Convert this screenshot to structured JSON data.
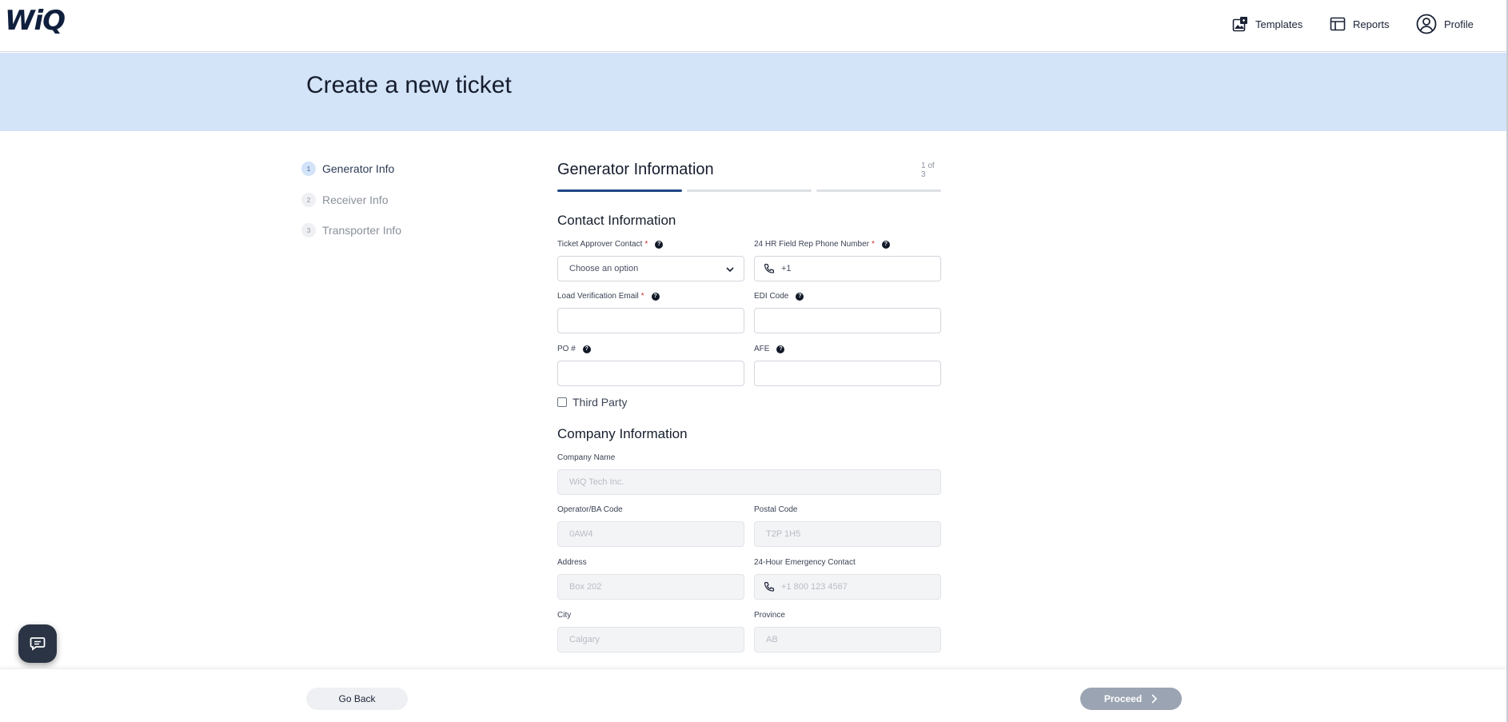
{
  "app": {
    "logo": "WiQ"
  },
  "nav": {
    "templates": "Templates",
    "reports": "Reports",
    "profile": "Profile"
  },
  "banner": {
    "title": "Create a new ticket"
  },
  "steps": [
    {
      "num": "1",
      "label": "Generator Info",
      "active": true
    },
    {
      "num": "2",
      "label": "Receiver Info",
      "active": false
    },
    {
      "num": "3",
      "label": "Transporter Info",
      "active": false
    }
  ],
  "form": {
    "title": "Generator Information",
    "counter": "1 of 3",
    "contact": {
      "title": "Contact Information",
      "ticket_approver_label": "Ticket Approver Contact",
      "ticket_approver_placeholder": "Choose an option",
      "field_rep_label": "24 HR Field Rep Phone Number",
      "field_rep_value": "+1",
      "load_email_label": "Load Verification Email",
      "edi_label": "EDI Code",
      "po_label": "PO #",
      "afe_label": "AFE",
      "third_party_label": "Third Party",
      "required_mark": "*",
      "help_mark": "?"
    },
    "company": {
      "title": "Company Information",
      "name_label": "Company Name",
      "name_value": "WiQ Tech Inc.",
      "operator_label": "Operator/BA Code",
      "operator_value": "0AW4",
      "postal_label": "Postal Code",
      "postal_value": "T2P 1H5",
      "address_label": "Address",
      "address_value": "Box 202",
      "emergency_label": "24-Hour Emergency Contact",
      "emergency_value": "+1 800 123 4567",
      "city_label": "City",
      "city_value": "Calgary",
      "province_label": "Province",
      "province_value": "AB"
    }
  },
  "footer": {
    "back_label": "Go Back",
    "proceed_label": "Proceed"
  },
  "colors": {
    "brand": "#0f1f3d",
    "banner": "#d3e3f8",
    "progress_active": "#1e4683",
    "required": "#d12d2d",
    "proceed_disabled": "#9ba4b2"
  }
}
